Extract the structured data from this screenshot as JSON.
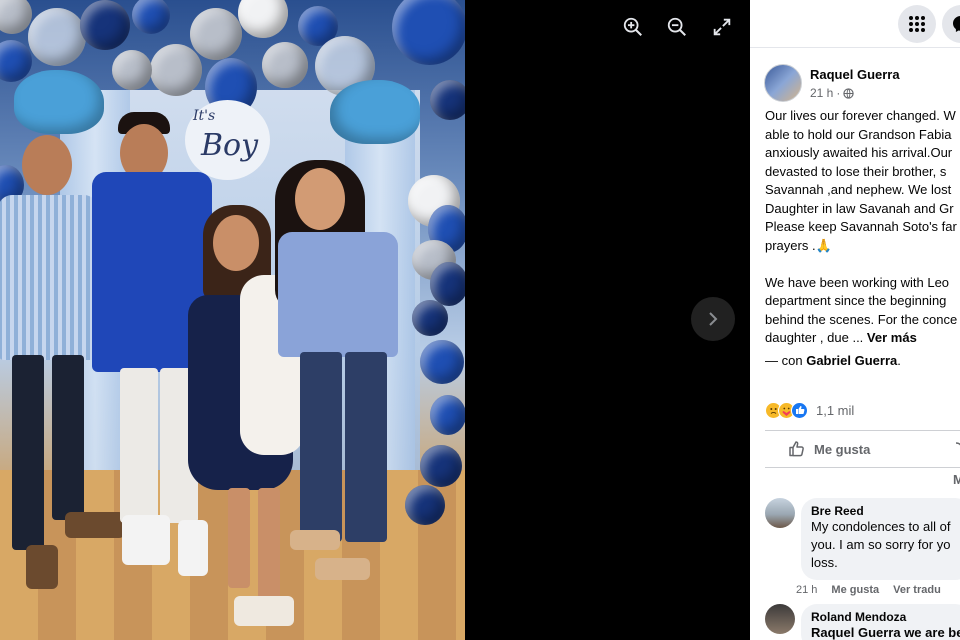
{
  "viewer": {
    "photo_sign_line1": "It's",
    "photo_sign_line2": "Boy",
    "zoom_in_icon": "zoom-in-icon",
    "zoom_out_icon": "zoom-out-icon",
    "fullscreen_icon": "fullscreen-icon",
    "next_icon": "chevron-right-icon"
  },
  "topbar": {
    "menu_icon": "grid-menu-icon",
    "messenger_icon": "messenger-icon"
  },
  "post": {
    "author": "Raquel Guerra",
    "time": "21 h",
    "separator": "·",
    "audience_icon": "globe-icon",
    "lines": [
      "Our lives our forever changed. W",
      "able to hold our Grandson Fabia",
      "anxiously awaited his arrival.Our",
      "devasted to lose their brother, s",
      "Savannah ,and nephew. We lost",
      "Daughter in law Savanah and Gr",
      "Please keep Savannah Soto's far",
      "prayers .🙏"
    ],
    "lines2": [
      "We have been working with Leo",
      "department since the beginning",
      "behind the scenes. For the conce",
      "daughter , due ..."
    ],
    "see_more": "Ver más",
    "with_prefix": "— con",
    "with_name": "Gabriel Guerra",
    "with_suffix": ".",
    "reaction_icons": [
      "sad-icon",
      "care-icon",
      "like-icon"
    ],
    "reaction_count": "1,1 mil",
    "like_label": "Me gusta",
    "cut_letter": "M"
  },
  "comments": [
    {
      "name": "Bre Reed",
      "lines": [
        "My condolences to all of",
        "you. I am so sorry for yo",
        "loss."
      ],
      "time": "21 h",
      "like": "Me gusta",
      "translate": "Ver tradu"
    },
    {
      "name": "Roland Mendoza",
      "lines": [
        "Raquel Guerra we are be"
      ]
    }
  ],
  "colors": {
    "panel_bg": "#ffffff",
    "viewer_bg": "#000000",
    "text_primary": "#050505",
    "text_secondary": "#65676b",
    "bubble_bg": "#f0f2f5",
    "control_bg": "#e4e6eb"
  }
}
